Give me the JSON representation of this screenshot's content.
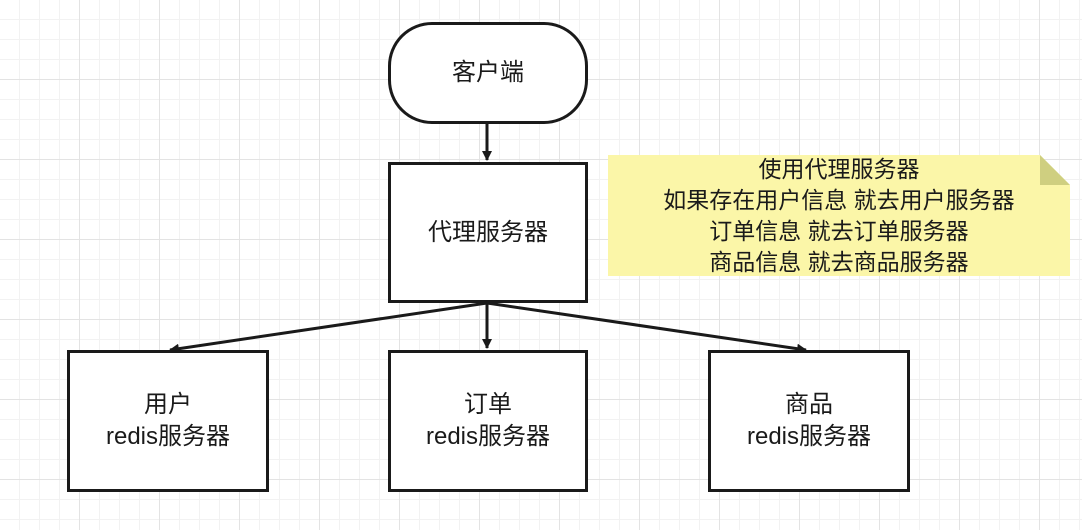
{
  "diagram": {
    "client": {
      "label": "客户端"
    },
    "proxy": {
      "label": "代理服务器"
    },
    "servers": [
      {
        "id": "user",
        "lines": [
          "用户",
          "redis服务器"
        ]
      },
      {
        "id": "order",
        "lines": [
          "订单",
          "redis服务器"
        ]
      },
      {
        "id": "product",
        "lines": [
          "商品",
          "redis服务器"
        ]
      }
    ],
    "note": {
      "lines": [
        "使用代理服务器",
        "如果存在用户信息 就去用户服务器",
        "订单信息 就去订单服务器",
        "商品信息 就去商品服务器"
      ]
    },
    "colors": {
      "stroke": "#1a1a1a",
      "note_fill": "#fbf6a8",
      "note_fold": "#cfcf80",
      "node_fill": "#ffffff"
    }
  }
}
